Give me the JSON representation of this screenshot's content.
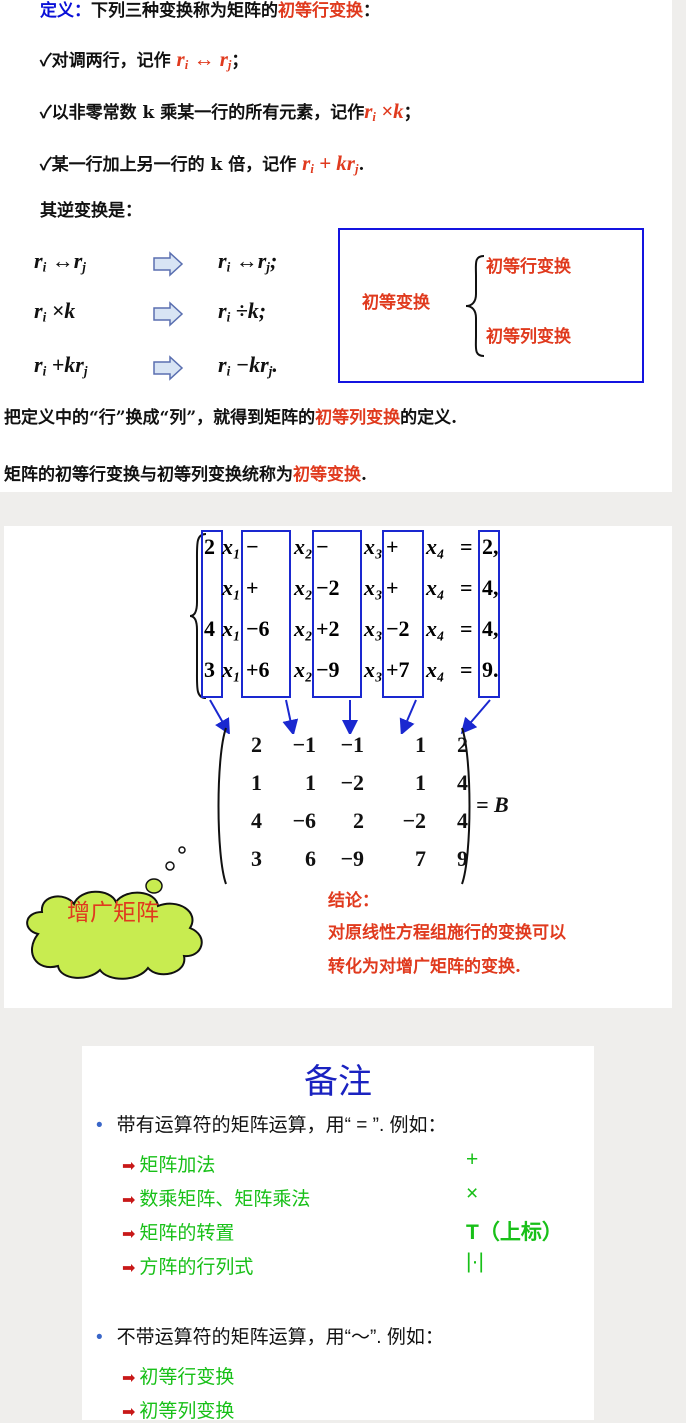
{
  "panel1": {
    "def_label": "定义：",
    "def_text": "下列三种变换称为矩阵的",
    "def_highlight": "初等行变换",
    "def_end": "：",
    "item1_text": "✓对调两行，记作 ",
    "item1_math": "r_i ↔ r_j",
    "item1_end": "；",
    "item2_text": "✓以非零常数 k 乘某一行的所有元素，记作",
    "item2_math": "r_i × k",
    "item2_end": "；",
    "item3_text": "✓某一行加上另一行的 k 倍，记作 ",
    "item3_math": "r_i + kr_j",
    "item3_end": ".",
    "inverse_label": "其逆变换是：",
    "inverse_rows": [
      {
        "left": "r_i ↔ r_j",
        "right": "r_i ↔ r_j;"
      },
      {
        "left": "r_i × k",
        "right": "r_i ÷ k;"
      },
      {
        "left": "r_i + kr_j",
        "right": "r_i − kr_j."
      }
    ],
    "box_label": "初等变换",
    "box_top": "初等行变换",
    "box_bottom": "初等列变换",
    "footer1": "把定义中的“行”换成“列”，就得到矩阵的",
    "footer1_highlight": "初等列变换",
    "footer1_end": "的定义.",
    "footer2": "矩阵的初等行变换与初等列变换统称为",
    "footer2_highlight": "初等变换",
    "footer2_end": "."
  },
  "panel2": {
    "equations": [
      [
        "2",
        "x₁",
        "−",
        "x₂",
        "−",
        "x₃",
        "+",
        "x₄",
        "=",
        "2,"
      ],
      [
        "",
        "x₁",
        "+",
        "x₂",
        "−2",
        "x₃",
        "+",
        "x₄",
        "=",
        "4,"
      ],
      [
        "4",
        "x₁",
        "−6",
        "x₂",
        "+2",
        "x₃",
        "−2",
        "x₄",
        "=",
        "4,"
      ],
      [
        "3",
        "x₁",
        "+6",
        "x₂",
        "−9",
        "x₃",
        "+7",
        "x₄",
        "=",
        "9."
      ]
    ],
    "matrix": [
      [
        "2",
        "−1",
        "−1",
        "1",
        "2"
      ],
      [
        "1",
        "1",
        "−2",
        "1",
        "4"
      ],
      [
        "4",
        "−6",
        "2",
        "−2",
        "4"
      ],
      [
        "3",
        "6",
        "−9",
        "7",
        "9"
      ]
    ],
    "matrix_name": "= B",
    "cloud_text": "增广矩阵",
    "conclusion_title": "结论：",
    "conclusion_line1": "对原线性方程组施行的变换可以",
    "conclusion_line2": "转化为对增广矩阵的变换."
  },
  "panel3": {
    "title": "备注",
    "bullet1": "带有运算符的矩阵运算，用“ = ”. 例如：",
    "items1": [
      {
        "label": "矩阵加法",
        "symbol": "+"
      },
      {
        "label": "数乘矩阵、矩阵乘法",
        "symbol": "×"
      },
      {
        "label": "矩阵的转置",
        "symbol": "T（上标）"
      },
      {
        "label": "方阵的行列式",
        "symbol": "|·|"
      }
    ],
    "bullet2": "不带运算符的矩阵运算，用“～”. 例如：",
    "items2": [
      {
        "label": "初等行变换"
      },
      {
        "label": "初等列变换"
      }
    ]
  },
  "colors": {
    "red": "#e03a1e",
    "blue": "#0a10d8",
    "green": "#18c018",
    "box": "#1414e0"
  }
}
